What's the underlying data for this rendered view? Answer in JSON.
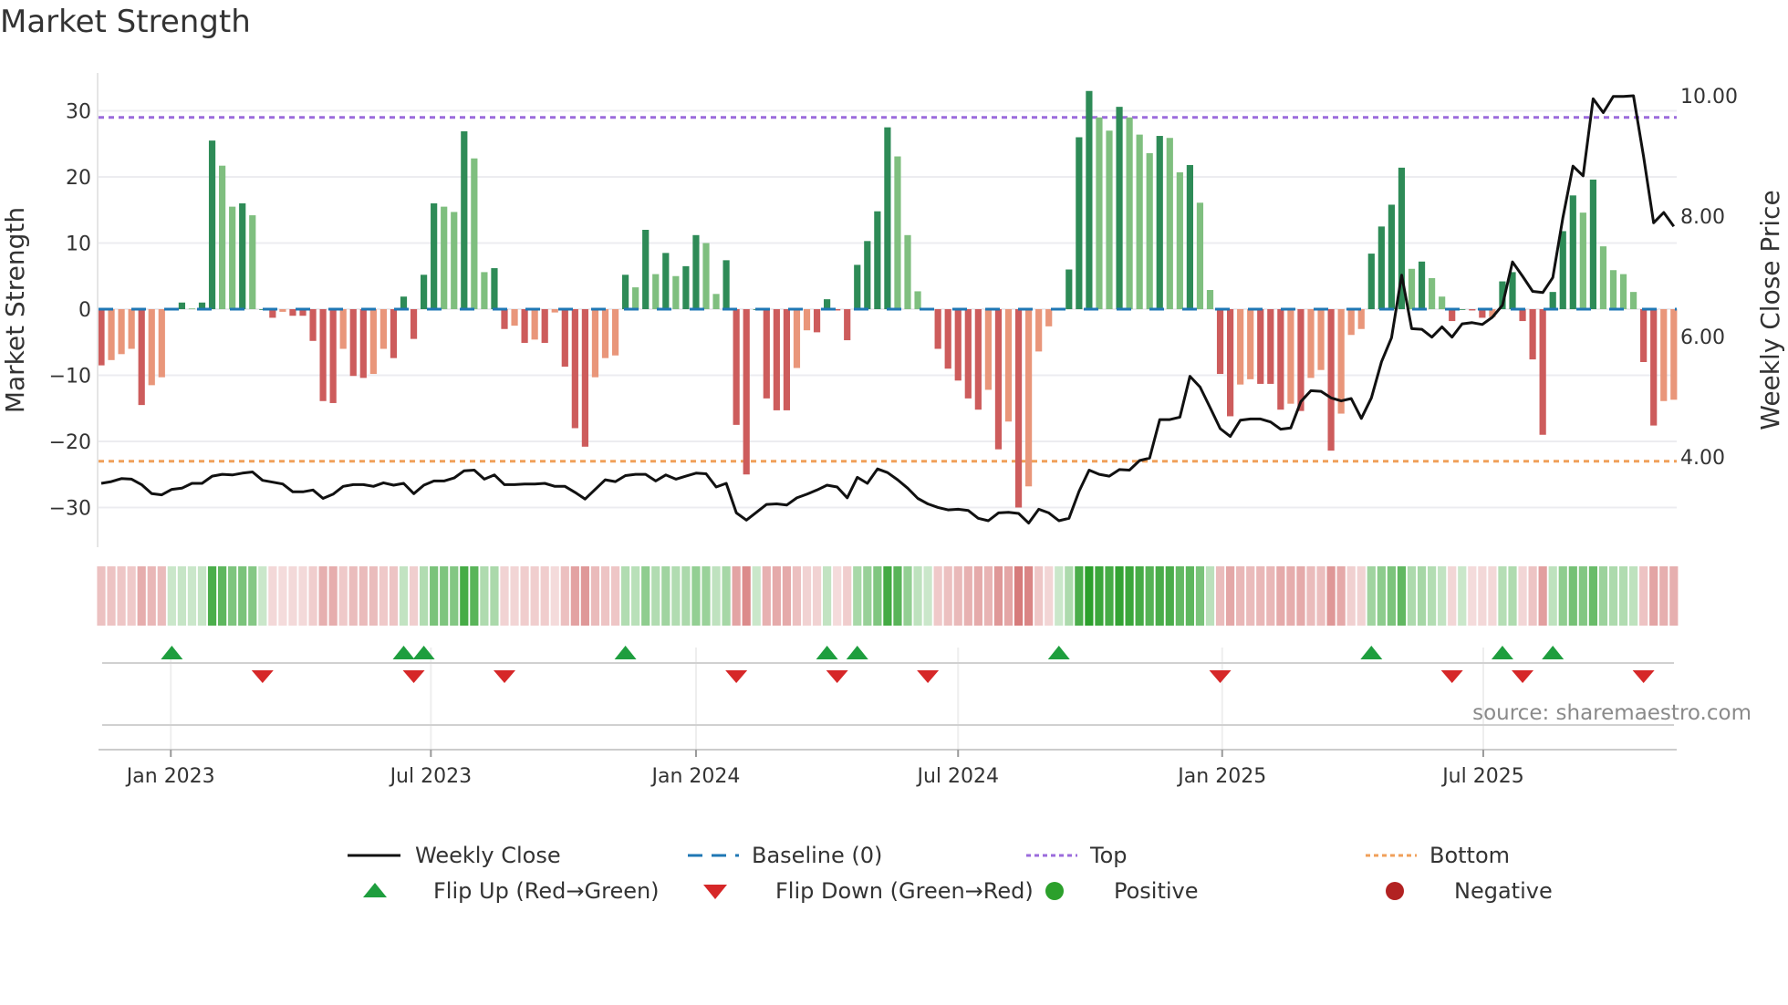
{
  "title": "Market Strength",
  "source": "source: sharemaestro.com",
  "colors": {
    "pos_strong": "#2e8b57",
    "pos_weak": "#7fbf7f",
    "neg_strong": "#cd5c5c",
    "neg_weak": "#e9967a",
    "baseline": "#1f77b4",
    "top": "#9b6bdc",
    "bottom": "#f0a05a",
    "close": "#111111",
    "flip_up": "#1e9e3e",
    "flip_down": "#d62728",
    "positive": "#2ca02c",
    "negative": "#b22222"
  },
  "legend": {
    "weekly_close": "Weekly Close",
    "baseline": "Baseline (0)",
    "top": "Top",
    "bottom": "Bottom",
    "flip_up": "Flip Up (Red→Green)",
    "flip_down": "Flip Down (Green→Red)",
    "positive": "Positive",
    "negative": "Negative"
  },
  "chart_data": {
    "type": "bar",
    "title": "Market Strength",
    "ylabel": "Market Strength",
    "y2label": "Weekly Close Price",
    "ylim": [
      -36,
      37
    ],
    "y2lim": [
      2.6,
      10.5
    ],
    "y_ticks": [
      {
        "value": 30,
        "label": "30"
      },
      {
        "value": 20,
        "label": "20"
      },
      {
        "value": 10,
        "label": "10"
      },
      {
        "value": 0,
        "label": "0"
      },
      {
        "value": -10,
        "label": "−10"
      },
      {
        "value": -20,
        "label": "−20"
      },
      {
        "value": -30,
        "label": "−30"
      }
    ],
    "y2_ticks": [
      {
        "value": 10,
        "label": "10.00"
      },
      {
        "value": 8,
        "label": "8.00"
      },
      {
        "value": 6,
        "label": "6.00"
      },
      {
        "value": 4,
        "label": "4.00"
      }
    ],
    "x_ticks": [
      {
        "week": 6.9,
        "label": "Jan 2023"
      },
      {
        "week": 32.7,
        "label": "Jul 2023"
      },
      {
        "week": 59.0,
        "label": "Jan 2024"
      },
      {
        "week": 85.0,
        "label": "Jul 2024"
      },
      {
        "week": 111.2,
        "label": "Jan 2025"
      },
      {
        "week": 137.1,
        "label": "Jul 2025"
      }
    ],
    "top_level": 29,
    "bottom_level": -23,
    "strength": [
      -8.5,
      -7.7,
      -6.8,
      -6,
      -14.5,
      -11.5,
      -10.3,
      0,
      1,
      0.1,
      1,
      25.5,
      21.7,
      15.5,
      16,
      14.2,
      0,
      -1.3,
      -0.4,
      -1,
      -1,
      -4.8,
      -13.9,
      -14.2,
      -6,
      -10.1,
      -10.4,
      -9.8,
      -6,
      -7.4,
      1.9,
      -4.5,
      5.2,
      16,
      15.5,
      14.7,
      26.9,
      22.8,
      5.6,
      6.2,
      -3,
      -2.5,
      -5.1,
      -4.6,
      -5.1,
      -0.5,
      -8.7,
      -18,
      -20.8,
      -10.3,
      -7.4,
      -7,
      5.2,
      3.3,
      12,
      5.3,
      8.5,
      5,
      6.5,
      11.2,
      10,
      2.3,
      7.4,
      -17.5,
      -25,
      0,
      -13.5,
      -15.3,
      -15.3,
      -8.9,
      -3.2,
      -3.5,
      1.5,
      -0.2,
      -4.7,
      6.7,
      10.3,
      14.8,
      27.5,
      23.1,
      11.2,
      2.7,
      0,
      -6,
      -9,
      -10.8,
      -13.5,
      -15.2,
      -12.2,
      -21.2,
      -17,
      -30,
      -26.8,
      -6.4,
      -2.6,
      0,
      6,
      26,
      33,
      29,
      27,
      30.6,
      29,
      26.4,
      23.6,
      26.2,
      25.9,
      20.7,
      21.8,
      16.1,
      2.9,
      -9.8,
      -16.2,
      -11.4,
      -10.6,
      -11.3,
      -11.3,
      -15.2,
      -14.3,
      -15.4,
      -10.4,
      -9.2,
      -21.4,
      -15.8,
      -3.9,
      -3,
      8.4,
      12.5,
      15.8,
      21.4,
      6.1,
      7.2,
      4.7,
      1.9,
      -1.8,
      0,
      -0.2,
      -1.3,
      -1.2,
      4.2,
      5.6,
      -1.8,
      -7.6,
      -19,
      2.6,
      11.8,
      17.2,
      14.6,
      19.6,
      9.5,
      5.9,
      5.3,
      2.6,
      -8,
      -17.6,
      -13.9,
      -13.7
    ],
    "weekly_close": [
      3.56,
      3.59,
      3.64,
      3.63,
      3.54,
      3.39,
      3.37,
      3.46,
      3.48,
      3.56,
      3.56,
      3.68,
      3.71,
      3.7,
      3.73,
      3.75,
      3.61,
      3.58,
      3.55,
      3.42,
      3.42,
      3.45,
      3.31,
      3.38,
      3.51,
      3.54,
      3.54,
      3.51,
      3.57,
      3.53,
      3.56,
      3.39,
      3.53,
      3.6,
      3.6,
      3.65,
      3.77,
      3.78,
      3.63,
      3.7,
      3.54,
      3.54,
      3.55,
      3.55,
      3.56,
      3.51,
      3.51,
      3.41,
      3.3,
      3.46,
      3.62,
      3.59,
      3.69,
      3.71,
      3.71,
      3.6,
      3.7,
      3.63,
      3.68,
      3.73,
      3.72,
      3.5,
      3.56,
      3.07,
      2.95,
      3.08,
      3.21,
      3.22,
      3.2,
      3.32,
      3.38,
      3.45,
      3.53,
      3.5,
      3.32,
      3.66,
      3.56,
      3.8,
      3.74,
      3.62,
      3.48,
      3.31,
      3.22,
      3.16,
      3.12,
      3.13,
      3.11,
      2.98,
      2.94,
      3.07,
      3.08,
      3.06,
      2.9,
      3.13,
      3.07,
      2.94,
      2.98,
      3.43,
      3.78,
      3.71,
      3.68,
      3.79,
      3.78,
      3.94,
      3.98,
      4.62,
      4.62,
      4.66,
      5.34,
      5.16,
      4.82,
      4.47,
      4.34,
      4.61,
      4.63,
      4.63,
      4.58,
      4.46,
      4.48,
      4.92,
      5.1,
      5.09,
      4.98,
      4.93,
      4.97,
      4.64,
      4.98,
      5.58,
      5.98,
      7.02,
      6.13,
      6.12,
      5.99,
      6.16,
      5.99,
      6.21,
      6.23,
      6.2,
      6.32,
      6.52,
      7.24,
      7.0,
      6.75,
      6.73,
      6.98,
      7.98,
      8.83,
      8.67,
      9.95,
      9.72,
      9.99,
      9.99,
      10.0,
      8.99,
      7.89,
      8.06,
      7.83
    ],
    "flip_up_weeks": [
      7,
      30,
      32,
      52,
      72,
      75,
      95,
      126,
      139,
      144
    ],
    "flip_down_weeks": [
      16,
      31,
      40,
      63,
      73,
      82,
      111,
      134,
      141,
      153
    ],
    "grid": true,
    "legend_position": "bottom"
  }
}
